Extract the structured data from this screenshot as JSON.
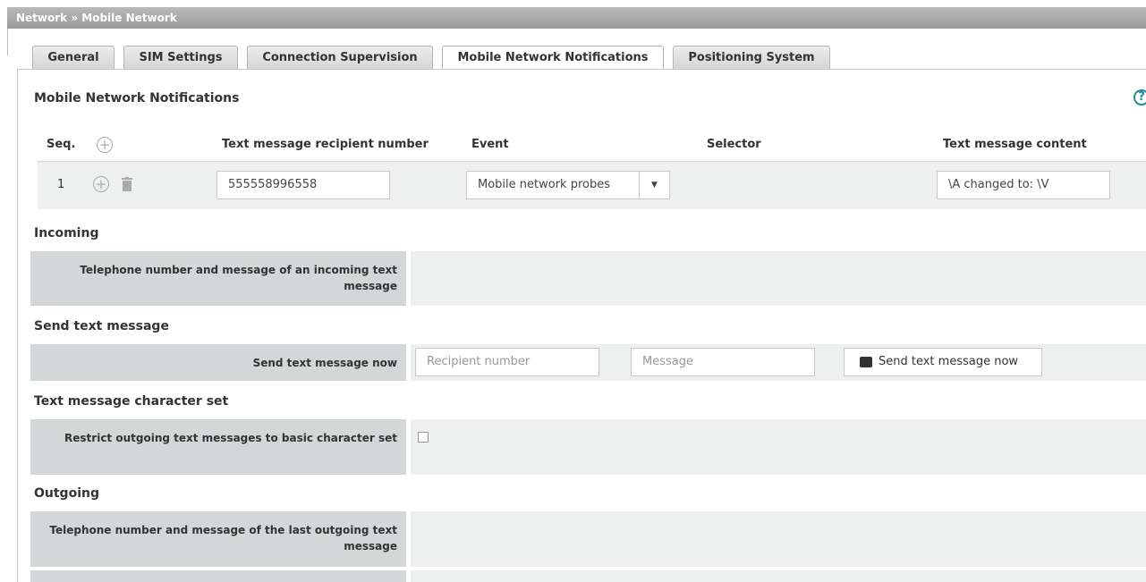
{
  "breadcrumb": "Network » Mobile Network",
  "tabs": [
    "General",
    "SIM Settings",
    "Connection Supervision",
    "Mobile Network Notifications",
    "Positioning System"
  ],
  "active_tab": "Mobile Network Notifications",
  "main": {
    "title": "Mobile Network Notifications",
    "help_icon": "?"
  },
  "table": {
    "headers": {
      "seq": "Seq.",
      "recipient": "Text message recipient number",
      "event": "Event",
      "selector": "Selector",
      "content": "Text message content"
    },
    "rows": [
      {
        "seq": "1",
        "recipient": "555558996558",
        "event": "Mobile network probes",
        "content": "\\A changed to: \\V"
      }
    ]
  },
  "incoming": {
    "title": "Incoming",
    "label": "Telephone number and message of an incoming text message"
  },
  "send": {
    "title": "Send text message",
    "label": "Send text message now",
    "recipient_placeholder": "Recipient number",
    "message_placeholder": "Message",
    "button": "Send text message now"
  },
  "charset": {
    "title": "Text message character set",
    "label": "Restrict outgoing text messages to basic character set"
  },
  "outgoing": {
    "title": "Outgoing",
    "label": "Telephone number and message of the last outgoing text message"
  },
  "colors": {
    "accent": "#1c8ea0",
    "label_bg": "#d3d7d7",
    "value_bg": "#eef0f0"
  }
}
